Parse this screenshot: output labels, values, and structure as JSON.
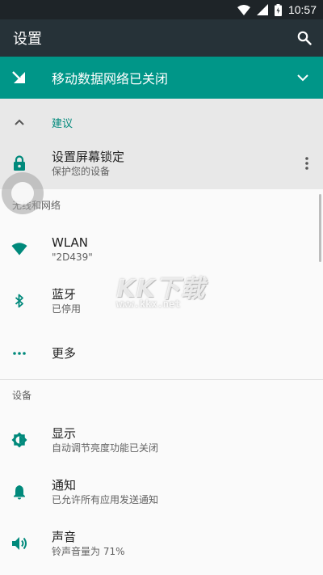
{
  "status_bar": {
    "time": "10:57",
    "icons": [
      "wifi-icon",
      "signal-icon",
      "battery-icon"
    ]
  },
  "toolbar": {
    "title": "设置",
    "search_icon": "search-icon"
  },
  "banner": {
    "text": "移动数据网络已关闭",
    "icon": "mobile-data-off-icon",
    "expand_icon": "chevron-down-icon",
    "color": "#009688"
  },
  "suggestions": {
    "collapse_label": "建议",
    "lock": {
      "title": "设置屏幕锁定",
      "summary": "保护您的设备"
    }
  },
  "sections": {
    "wireless": {
      "header": "无线和网络",
      "wlan": {
        "title": "WLAN",
        "summary": "\"2D439\""
      },
      "bluetooth": {
        "title": "蓝牙",
        "summary": "已停用"
      },
      "more": {
        "title": "更多"
      }
    },
    "device": {
      "header": "设备",
      "display": {
        "title": "显示",
        "summary": "自动调节亮度功能已关闭"
      },
      "notifications": {
        "title": "通知",
        "summary": "已允许所有应用发送通知"
      },
      "sound": {
        "title": "声音",
        "summary": "铃声音量为 71%"
      }
    }
  },
  "watermark": {
    "logo": "KK下载",
    "url": "www.kkx.net"
  },
  "colors": {
    "accent": "#009688",
    "toolbar": "#263238",
    "statusbar": "#1e2428",
    "icon_teal": "#00897b"
  }
}
